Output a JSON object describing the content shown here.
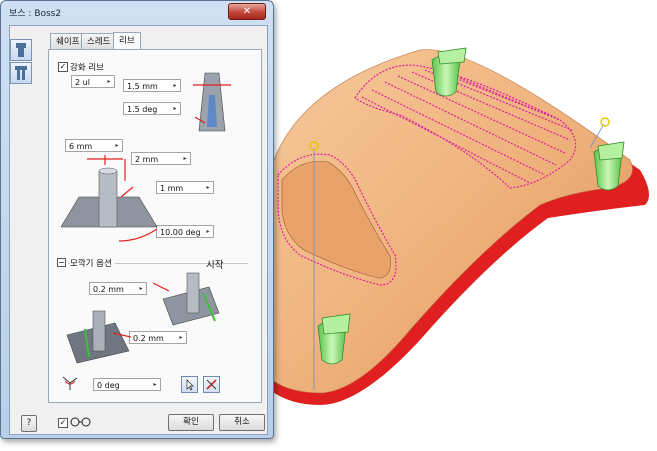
{
  "dialog": {
    "title": "보스 : Boss2",
    "close_glyph": "✕",
    "tabs": [
      {
        "label": "쉐이프",
        "active": false
      },
      {
        "label": "스레드",
        "active": false
      },
      {
        "label": "리브",
        "active": true
      }
    ],
    "rib": {
      "enable_label": "강화 리브",
      "enable_checked": true,
      "count_value": "2 ul",
      "thickness_value": "1.5 mm",
      "draft_value": "1.5 deg",
      "offset_value": "6 mm",
      "top_gap_value": "2 mm",
      "width_value": "1 mm",
      "angle_value": "10.00 deg"
    },
    "chamfer": {
      "section_label": "모깍기 옵션",
      "start_label": "시작",
      "fillet_top_value": "0.2 mm",
      "fillet_bottom_value": "0.2 mm"
    },
    "rotation_value": "0 deg",
    "ok_label": "확인",
    "cancel_label": "취소",
    "help_glyph": "?",
    "preview_checked": true
  },
  "colors": {
    "accent_red": "#e02020",
    "body_orange": "#f0b27a",
    "rib_magenta": "#e0209c",
    "boss_green": "#8ee67a"
  }
}
